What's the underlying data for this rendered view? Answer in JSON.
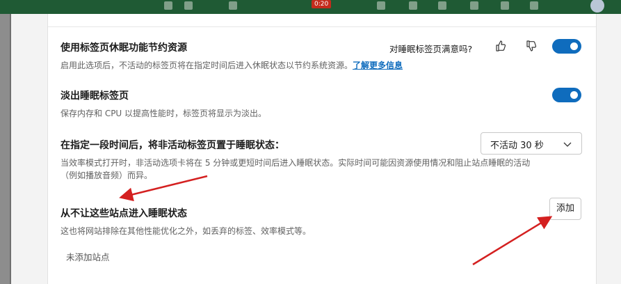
{
  "topbar": {
    "badge": "0:20"
  },
  "settings": {
    "sleeping_tabs": {
      "title": "使用标签页休眠功能节约资源",
      "desc": "启用此选项后，不活动的标签页将在指定时间后进入休眠状态以节约系统资源。",
      "link": "了解更多信息",
      "survey": "对睡眠标签页满意吗?",
      "enabled": true
    },
    "fade": {
      "title": "淡出睡眠标签页",
      "desc": "保存内存和 CPU 以提高性能时，标签页将显示为淡出。",
      "enabled": true
    },
    "timeout": {
      "title": "在指定一段时间后，将非活动标签页置于睡眠状态：",
      "desc1": "当效率模式打开时，非活动选项卡将在 5 分钟或更短时间后进入睡眠状态。实际时间可能因资源使用情况和阻止站点睡眠的活动",
      "desc2": "（例如播放音频）而异。",
      "selected": "不活动 30 秒"
    },
    "never_sleep": {
      "title": "从不让这些站点进入睡眠状态",
      "desc": "这也将网站排除在其他性能优化之外，如丢弃的标签、效率模式等。",
      "add_label": "添加",
      "empty_text": "未添加站点"
    }
  },
  "colors": {
    "accent": "#0f6cbd",
    "annotation": "#d42020"
  }
}
